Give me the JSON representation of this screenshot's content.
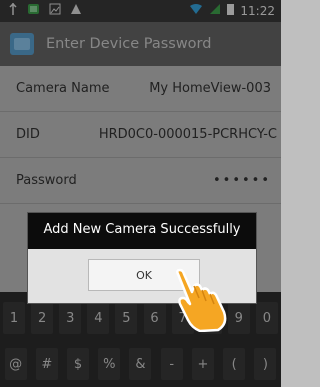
{
  "status_bar": {
    "time": "11:22",
    "icons": [
      "usb-icon",
      "notification-icon",
      "image-icon",
      "warning-icon",
      "wifi-icon",
      "signal-icon",
      "battery-icon"
    ]
  },
  "action_bar": {
    "title": "Enter Device Password",
    "icon": "camera-app-icon"
  },
  "form": {
    "camera_name_label": "Camera Name",
    "camera_name_value": "My HomeView-003",
    "did_label": "DID",
    "did_value": "HRD0C0-000015-PCRHCY-C",
    "password_label": "Password",
    "password_value": "••••••"
  },
  "dialog": {
    "message": "Add New Camera Successfully",
    "ok_label": "OK"
  },
  "keyboard": {
    "row1": [
      "1",
      "2",
      "3",
      "4",
      "5",
      "6",
      "7",
      "8",
      "9",
      "0"
    ],
    "row2": [
      "@",
      "#",
      "$",
      "%",
      "&",
      "-",
      "+",
      "(",
      ")"
    ]
  },
  "colors": {
    "action_bar": "#666666",
    "dialog_bg": "#0c0c0c",
    "hand": "#f5a623"
  }
}
